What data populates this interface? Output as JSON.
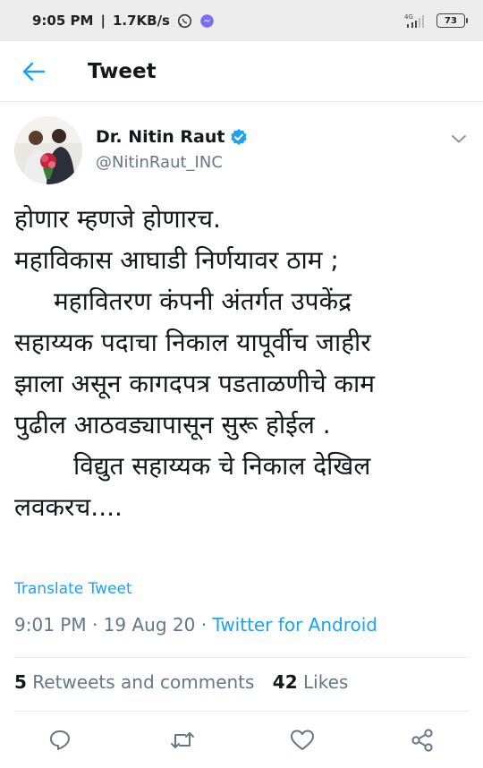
{
  "status_bar": {
    "time": "9:05 PM",
    "separator": "|",
    "speed": "1.7KB/s",
    "network": "4G",
    "battery": "73",
    "icons": [
      "whatsapp-icon",
      "messenger-icon",
      "signal-icon",
      "battery-icon"
    ]
  },
  "header": {
    "title": "Tweet",
    "back_icon": "back-arrow-icon"
  },
  "author": {
    "display_name": "Dr. Nitin Raut",
    "handle": "@NitinRaut_INC",
    "verified_icon": "verified-badge-icon"
  },
  "tweet": {
    "lines": [
      "होणार म्हणजे होणारच.",
      "महाविकास आघाडी निर्णयावर ठाम ;",
      "महावितरण कंपनी अंतर्गत उपकेंद्र",
      "सहाय्यक पदाचा निकाल यापूर्वीच जाहीर",
      "झाला असून कागदपत्र पडताळणीचे काम",
      "पुढील आठवड्यापासून सुरू होईल .",
      "विद्युत सहाय्यक चे निकाल देखिल",
      "लवकरच...."
    ],
    "translate_label": "Translate Tweet",
    "time": "9:01 PM",
    "date": "19 Aug 20",
    "dot": "·",
    "source": "Twitter for Android"
  },
  "stats": {
    "retweets_count": "5",
    "retweets_label": "Retweets and comments",
    "likes_count": "42",
    "likes_label": "Likes"
  },
  "actions": [
    "reply-icon",
    "retweet-icon",
    "like-icon",
    "share-icon"
  ],
  "colors": {
    "accent": "#1da1f2",
    "secondary_text": "#657786",
    "primary_text": "#14171a",
    "status_bar_bg": "#ececec"
  }
}
